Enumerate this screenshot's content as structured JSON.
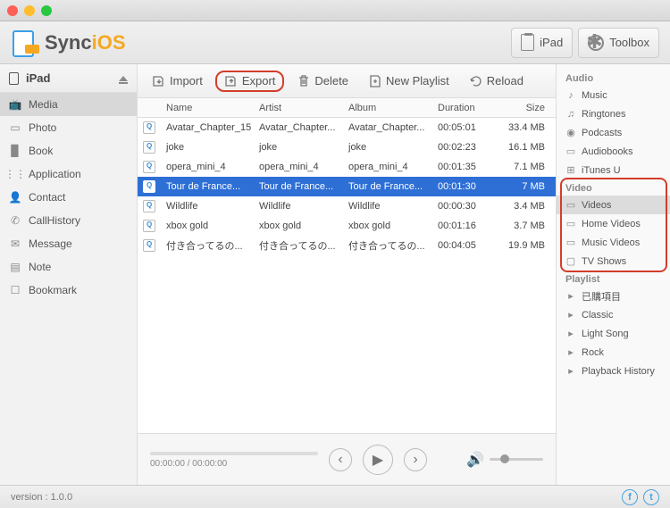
{
  "app": {
    "name_a": "Sync",
    "name_b": "iOS"
  },
  "header_buttons": {
    "ipad": "iPad",
    "toolbox": "Toolbox"
  },
  "device": {
    "name": "iPad"
  },
  "left_nav": [
    {
      "icon": "📺",
      "label": "Media",
      "selected": true
    },
    {
      "icon": "▭",
      "label": "Photo"
    },
    {
      "icon": "▉",
      "label": "Book"
    },
    {
      "icon": "⋮⋮",
      "label": "Application"
    },
    {
      "icon": "👤",
      "label": "Contact"
    },
    {
      "icon": "✆",
      "label": "CallHistory"
    },
    {
      "icon": "✉",
      "label": "Message"
    },
    {
      "icon": "▤",
      "label": "Note"
    },
    {
      "icon": "☐",
      "label": "Bookmark"
    }
  ],
  "toolbar": {
    "import": "Import",
    "export": "Export",
    "delete": "Delete",
    "new_playlist": "New Playlist",
    "reload": "Reload"
  },
  "columns": {
    "name": "Name",
    "artist": "Artist",
    "album": "Album",
    "duration": "Duration",
    "size": "Size"
  },
  "rows": [
    {
      "name": "Avatar_Chapter_15",
      "artist": "Avatar_Chapter...",
      "album": "Avatar_Chapter...",
      "duration": "00:05:01",
      "size": "33.4 MB"
    },
    {
      "name": "joke",
      "artist": "joke",
      "album": "joke",
      "duration": "00:02:23",
      "size": "16.1 MB"
    },
    {
      "name": "opera_mini_4",
      "artist": "opera_mini_4",
      "album": "opera_mini_4",
      "duration": "00:01:35",
      "size": "7.1 MB"
    },
    {
      "name": "Tour de France...",
      "artist": "Tour de France...",
      "album": "Tour de France...",
      "duration": "00:01:30",
      "size": "7 MB",
      "selected": true
    },
    {
      "name": "Wildlife",
      "artist": "Wildlife",
      "album": "Wildlife",
      "duration": "00:00:30",
      "size": "3.4 MB"
    },
    {
      "name": "xbox gold",
      "artist": "xbox gold",
      "album": "xbox gold",
      "duration": "00:01:16",
      "size": "3.7 MB"
    },
    {
      "name": "付き合ってるの...",
      "artist": "付き合ってるの...",
      "album": "付き合ってるの...",
      "duration": "00:04:05",
      "size": "19.9 MB"
    }
  ],
  "player": {
    "time": "00:00:00 / 00:00:00"
  },
  "right": {
    "audio": {
      "title": "Audio",
      "items": [
        {
          "icon": "♪",
          "label": "Music"
        },
        {
          "icon": "♫",
          "label": "Ringtones"
        },
        {
          "icon": "◉",
          "label": "Podcasts"
        },
        {
          "icon": "▭",
          "label": "Audiobooks"
        },
        {
          "icon": "⊞",
          "label": "iTunes U"
        }
      ]
    },
    "video": {
      "title": "Video",
      "items": [
        {
          "icon": "▭",
          "label": "Videos",
          "selected": true
        },
        {
          "icon": "▭",
          "label": "Home Videos"
        },
        {
          "icon": "▭",
          "label": "Music Videos"
        },
        {
          "icon": "▢",
          "label": "TV Shows"
        }
      ]
    },
    "playlist": {
      "title": "Playlist",
      "items": [
        {
          "icon": "▸",
          "label": "已購項目"
        },
        {
          "icon": "▸",
          "label": "Classic"
        },
        {
          "icon": "▸",
          "label": "Light Song"
        },
        {
          "icon": "▸",
          "label": "Rock"
        },
        {
          "icon": "▸",
          "label": "Playback History"
        }
      ]
    }
  },
  "footer": {
    "version": "version : 1.0.0"
  }
}
